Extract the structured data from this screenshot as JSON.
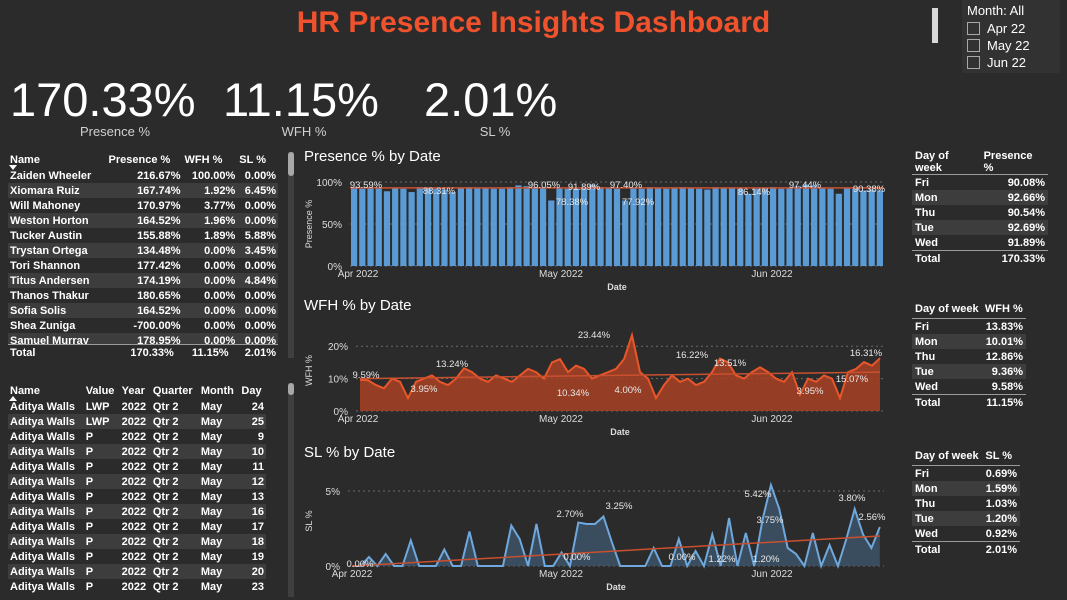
{
  "title": "HR Presence Insights Dashboard",
  "slicer": {
    "header": "Month: All",
    "options": [
      "Apr 22",
      "May 22",
      "Jun 22"
    ]
  },
  "kpis": [
    {
      "value": "170.33%",
      "label": "Presence %"
    },
    {
      "value": "11.15%",
      "label": "WFH %"
    },
    {
      "value": "2.01%",
      "label": "SL %"
    }
  ],
  "summary_table": {
    "columns": [
      "Name",
      "Presence %",
      "WFH %",
      "SL %"
    ],
    "rows": [
      [
        "Zaiden Wheeler",
        "216.67%",
        "100.00%",
        "0.00%"
      ],
      [
        "Xiomara Ruiz",
        "167.74%",
        "1.92%",
        "6.45%"
      ],
      [
        "Will Mahoney",
        "170.97%",
        "3.77%",
        "0.00%"
      ],
      [
        "Weston Horton",
        "164.52%",
        "1.96%",
        "0.00%"
      ],
      [
        "Tucker Austin",
        "155.88%",
        "1.89%",
        "5.88%"
      ],
      [
        "Trystan Ortega",
        "134.48%",
        "0.00%",
        "3.45%"
      ],
      [
        "Tori Shannon",
        "177.42%",
        "0.00%",
        "0.00%"
      ],
      [
        "Titus Andersen",
        "174.19%",
        "0.00%",
        "4.84%"
      ],
      [
        "Thanos Thakur",
        "180.65%",
        "0.00%",
        "0.00%"
      ],
      [
        "Sofia Solis",
        "164.52%",
        "0.00%",
        "0.00%"
      ],
      [
        "Shea Zuniga",
        "-700.00%",
        "0.00%",
        "0.00%"
      ],
      [
        "Samuel Murray",
        "178.95%",
        "0.00%",
        "0.00%"
      ]
    ],
    "total": [
      "Total",
      "170.33%",
      "11.15%",
      "2.01%"
    ]
  },
  "detail_table": {
    "columns": [
      "Name",
      "Value",
      "Year",
      "Quarter",
      "Month",
      "Day"
    ],
    "rows": [
      [
        "Aditya Walls",
        "LWP",
        "2022",
        "Qtr 2",
        "May",
        "24"
      ],
      [
        "Aditya Walls",
        "LWP",
        "2022",
        "Qtr 2",
        "May",
        "25"
      ],
      [
        "Aditya Walls",
        "P",
        "2022",
        "Qtr 2",
        "May",
        "9"
      ],
      [
        "Aditya Walls",
        "P",
        "2022",
        "Qtr 2",
        "May",
        "10"
      ],
      [
        "Aditya Walls",
        "P",
        "2022",
        "Qtr 2",
        "May",
        "11"
      ],
      [
        "Aditya Walls",
        "P",
        "2022",
        "Qtr 2",
        "May",
        "12"
      ],
      [
        "Aditya Walls",
        "P",
        "2022",
        "Qtr 2",
        "May",
        "13"
      ],
      [
        "Aditya Walls",
        "P",
        "2022",
        "Qtr 2",
        "May",
        "16"
      ],
      [
        "Aditya Walls",
        "P",
        "2022",
        "Qtr 2",
        "May",
        "17"
      ],
      [
        "Aditya Walls",
        "P",
        "2022",
        "Qtr 2",
        "May",
        "18"
      ],
      [
        "Aditya Walls",
        "P",
        "2022",
        "Qtr 2",
        "May",
        "19"
      ],
      [
        "Aditya Walls",
        "P",
        "2022",
        "Qtr 2",
        "May",
        "20"
      ],
      [
        "Aditya Walls",
        "P",
        "2022",
        "Qtr 2",
        "May",
        "23"
      ]
    ]
  },
  "colors": {
    "accent": "#f0522d",
    "bar": "#5b9bd5",
    "wfh": "#e8562a",
    "sl": "#6fa8dc",
    "trend": "#c9502f",
    "background": "#2b2b2b"
  },
  "chart_data": [
    {
      "type": "bar",
      "title": "Presence % by Date",
      "xlabel": "Date",
      "ylabel": "Presence %",
      "ylim": [
        0,
        1
      ],
      "ytick_labels": [
        "0%",
        "50%",
        "100%"
      ],
      "xtick_labels": [
        "Apr 2022",
        "May 2022",
        "Jun 2022"
      ],
      "values": [
        0.94,
        0.92,
        0.94,
        0.93,
        0.89,
        0.93,
        0.92,
        0.88,
        0.94,
        0.93,
        0.92,
        0.91,
        0.88,
        0.93,
        0.94,
        0.93,
        0.93,
        0.92,
        0.92,
        0.94,
        0.96,
        0.95,
        0.94,
        0.93,
        0.78,
        0.93,
        0.92,
        0.92,
        0.93,
        0.97,
        0.94,
        0.93,
        0.92,
        0.78,
        0.93,
        0.92,
        0.94,
        0.93,
        0.92,
        0.93,
        0.94,
        0.93,
        0.92,
        0.91,
        0.94,
        0.93,
        0.93,
        0.92,
        0.86,
        0.92,
        0.93,
        0.94,
        0.92,
        0.93,
        0.95,
        0.97,
        0.96,
        0.93,
        0.92,
        0.86,
        0.93,
        0.92,
        0.9,
        0.91,
        0.9
      ],
      "data_labels": [
        "93.59%",
        "88.31%",
        "96.05%",
        "78.38%",
        "91.89%",
        "97.40%",
        "77.92%",
        "86.14%",
        "97.44%",
        "90.38%"
      ],
      "trend": "flat near 0.93"
    },
    {
      "type": "area",
      "title": "WFH % by Date",
      "xlabel": "Date",
      "ylabel": "WFH %",
      "ylim": [
        0,
        0.25
      ],
      "ytick_labels": [
        "0%",
        "10%",
        "20%"
      ],
      "xtick_labels": [
        "Apr 2022",
        "May 2022",
        "Jun 2022"
      ],
      "values": [
        0.096,
        0.095,
        0.08,
        0.07,
        0.1,
        0.09,
        0.04,
        0.09,
        0.1,
        0.11,
        0.09,
        0.08,
        0.1,
        0.132,
        0.12,
        0.1,
        0.09,
        0.11,
        0.1,
        0.09,
        0.11,
        0.13,
        0.12,
        0.1,
        0.15,
        0.16,
        0.12,
        0.14,
        0.13,
        0.1,
        0.11,
        0.12,
        0.13,
        0.16,
        0.234,
        0.12,
        0.1,
        0.04,
        0.08,
        0.11,
        0.09,
        0.1,
        0.08,
        0.09,
        0.12,
        0.162,
        0.15,
        0.11,
        0.1,
        0.12,
        0.135,
        0.12,
        0.1,
        0.09,
        0.12,
        0.05,
        0.1,
        0.09,
        0.11,
        0.1,
        0.04,
        0.12,
        0.13,
        0.151,
        0.14,
        0.163
      ],
      "data_labels": [
        "9.59%",
        "3.95%",
        "13.24%",
        "10.34%",
        "23.44%",
        "4.00%",
        "16.22%",
        "13.51%",
        "3.95%",
        "15.07%",
        "16.31%"
      ]
    },
    {
      "type": "area",
      "title": "SL % by Date",
      "xlabel": "Date",
      "ylabel": "SL %",
      "ylim": [
        0,
        0.06
      ],
      "ytick_labels": [
        "0%",
        "5%"
      ],
      "xtick_labels": [
        "Apr 2022",
        "May 2022",
        "Jun 2022"
      ],
      "values": [
        0.0,
        0.0,
        0.006,
        0.0,
        0.008,
        0.0,
        0.0,
        0.017,
        0.0,
        0.0,
        0.0,
        0.011,
        0.0,
        0.0,
        0.023,
        0.0,
        0.0,
        0.0,
        0.0,
        0.027,
        0.018,
        0.0,
        0.028,
        0.0,
        0.0,
        0.009,
        0.0,
        0.029,
        0.028,
        0.028,
        0.033,
        0.016,
        0.0,
        0.0,
        0.0,
        0.0,
        0.012,
        0.0,
        0.0,
        0.018,
        0.0,
        0.01,
        0.0,
        0.021,
        0.0,
        0.032,
        0.0,
        0.022,
        0.0,
        0.031,
        0.054,
        0.038,
        0.012,
        0.008,
        0.0,
        0.022,
        0.0,
        0.014,
        0.0,
        0.018,
        0.038,
        0.021,
        0.012,
        0.026
      ],
      "data_labels": [
        "0.00%",
        "2.70%",
        "3.25%",
        "0.00%",
        "0.00%",
        "1.22%",
        "5.42%",
        "3.75%",
        "1.20%",
        "3.80%",
        "2.56%"
      ]
    }
  ],
  "dow_tables": [
    {
      "columns": [
        "Day of week",
        "Presence %"
      ],
      "rows": [
        [
          "Fri",
          "90.08%"
        ],
        [
          "Mon",
          "92.66%"
        ],
        [
          "Thu",
          "90.54%"
        ],
        [
          "Tue",
          "92.69%"
        ],
        [
          "Wed",
          "91.89%"
        ]
      ],
      "total": [
        "Total",
        "170.33%"
      ]
    },
    {
      "columns": [
        "Day of week",
        "WFH %"
      ],
      "rows": [
        [
          "Fri",
          "13.83%"
        ],
        [
          "Mon",
          "10.01%"
        ],
        [
          "Thu",
          "12.86%"
        ],
        [
          "Tue",
          "9.36%"
        ],
        [
          "Wed",
          "9.58%"
        ]
      ],
      "total": [
        "Total",
        "11.15%"
      ]
    },
    {
      "columns": [
        "Day of week",
        "SL %"
      ],
      "rows": [
        [
          "Fri",
          "0.69%"
        ],
        [
          "Mon",
          "1.59%"
        ],
        [
          "Thu",
          "1.03%"
        ],
        [
          "Tue",
          "1.20%"
        ],
        [
          "Wed",
          "0.92%"
        ]
      ],
      "total": [
        "Total",
        "2.01%"
      ]
    }
  ]
}
